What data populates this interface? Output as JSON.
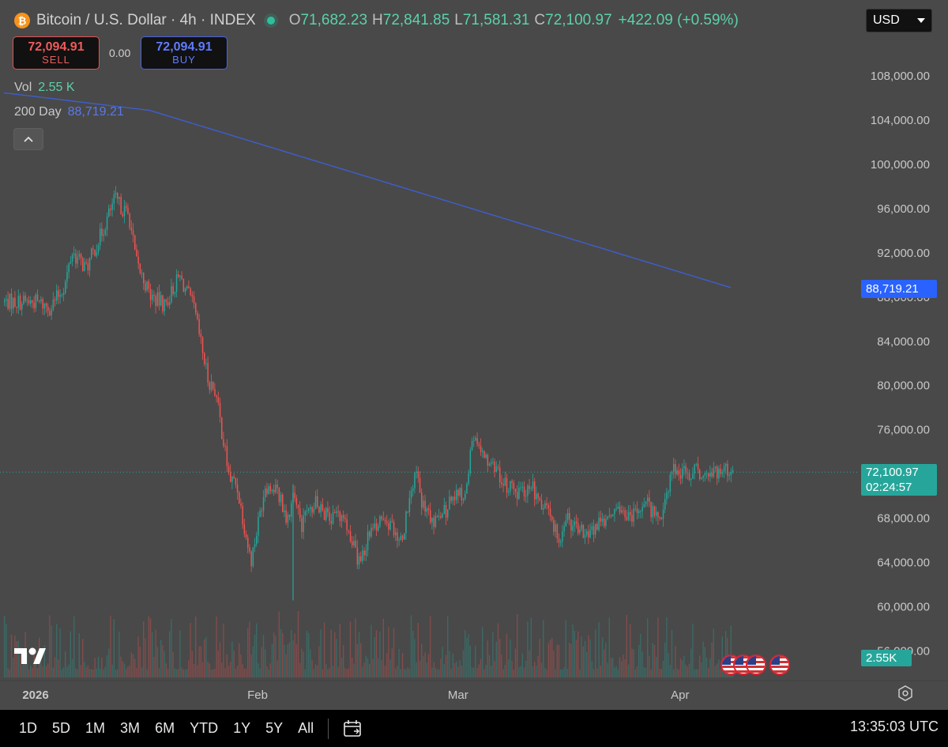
{
  "header": {
    "title": "Bitcoin / U.S. Dollar · 4h · INDEX",
    "icon": "bitcoin-icon",
    "ohlc": [
      {
        "k": "O",
        "v": "71,682.23"
      },
      {
        "k": "H",
        "v": "72,841.85"
      },
      {
        "k": "L",
        "v": "71,581.31"
      },
      {
        "k": "C",
        "v": "72,100.97"
      }
    ],
    "change": "+422.09 (+0.59%)"
  },
  "currency": {
    "selected": "USD",
    "icon": "chevron-down-icon"
  },
  "trade": {
    "sell_price": "72,094.91",
    "sell_label": "SELL",
    "spread": "0.00",
    "buy_price": "72,094.91",
    "buy_label": "BUY"
  },
  "indicators": {
    "vol_label": "Vol",
    "vol_value": "2.55 K",
    "ma_label": "200 Day",
    "ma_value": "88,719.21",
    "collapse_icon": "chevron-up-icon"
  },
  "tags": {
    "ma": "88,719.21",
    "last_price": "72,100.97",
    "countdown": "02:24:57",
    "volume": "2.55K"
  },
  "colors": {
    "up": "#26a69a",
    "down": "#ef5350",
    "ma": "#3e5ecf",
    "ma_tag": "#2962ff",
    "last_tag": "#26a69a",
    "background": "#494949"
  },
  "chart_data": {
    "type": "candlestick",
    "title": "Bitcoin / U.S. Dollar · 4h · INDEX",
    "x_ticks": [
      "2026",
      "Feb",
      "Mar",
      "Apr"
    ],
    "y_ticks": [
      "108,000.00",
      "104,000.00",
      "100,000.00",
      "96,000.00",
      "92,000.00",
      "88,000.00",
      "84,000.00",
      "80,000.00",
      "76,000.00",
      "72,000.00",
      "68,000.00",
      "64,000.00",
      "60,000.00",
      "56,000.00"
    ],
    "ylim": [
      54000,
      109500
    ],
    "price_path": {
      "x": [
        "2026-01-01",
        "2026-01-03",
        "2026-01-05",
        "2026-01-06",
        "2026-01-08",
        "2026-01-10",
        "2026-01-12",
        "2026-01-14",
        "2026-01-15",
        "2026-01-17",
        "2026-01-19",
        "2026-01-21",
        "2026-01-23",
        "2026-01-25",
        "2026-01-26",
        "2026-01-28",
        "2026-01-29",
        "2026-01-31",
        "2026-02-02",
        "2026-02-04",
        "2026-02-05",
        "2026-02-06",
        "2026-02-07",
        "2026-02-09",
        "2026-02-11",
        "2026-02-13",
        "2026-02-15",
        "2026-02-17",
        "2026-02-19",
        "2026-02-21",
        "2026-02-23",
        "2026-02-24",
        "2026-02-26",
        "2026-02-28",
        "2026-03-02",
        "2026-03-03",
        "2026-03-05",
        "2026-03-07",
        "2026-03-09",
        "2026-03-11",
        "2026-03-13",
        "2026-03-15",
        "2026-03-16",
        "2026-03-17",
        "2026-03-19",
        "2026-03-21",
        "2026-03-23",
        "2026-03-25",
        "2026-03-27",
        "2026-03-29",
        "2026-03-31",
        "2026-04-02",
        "2026-04-04",
        "2026-04-05",
        "2026-04-06"
      ],
      "close": [
        87500,
        87000,
        89000,
        92000,
        90500,
        93500,
        96800,
        95200,
        91000,
        88000,
        87200,
        89800,
        87000,
        80500,
        79500,
        71500,
        71000,
        64000,
        71000,
        70000,
        68000,
        70000,
        67200,
        69500,
        67800,
        68500,
        64000,
        67000,
        67800,
        66000,
        72000,
        69000,
        67500,
        69500,
        70500,
        75000,
        73500,
        71500,
        70000,
        71000,
        69000,
        66000,
        68000,
        67000,
        66500,
        67800,
        68500,
        68200,
        69500,
        67800,
        72400,
        72100,
        72100,
        72100,
        72100
      ]
    },
    "ma_200_end": 88719.21,
    "last_close": 72100.97,
    "volume_last": "2.55K"
  },
  "bottom": {
    "timeframes": [
      "1D",
      "5D",
      "1M",
      "3M",
      "6M",
      "YTD",
      "1Y",
      "5Y",
      "All"
    ],
    "calendar_icon": "calendar-icon",
    "clock": "13:35:03 UTC"
  },
  "settings_icon": "gear-icon",
  "logo_icon": "tradingview-logo-icon",
  "event_icons": [
    "us-flag-icon",
    "us-flag-icon",
    "us-flag-icon",
    "us-flag-icon"
  ]
}
